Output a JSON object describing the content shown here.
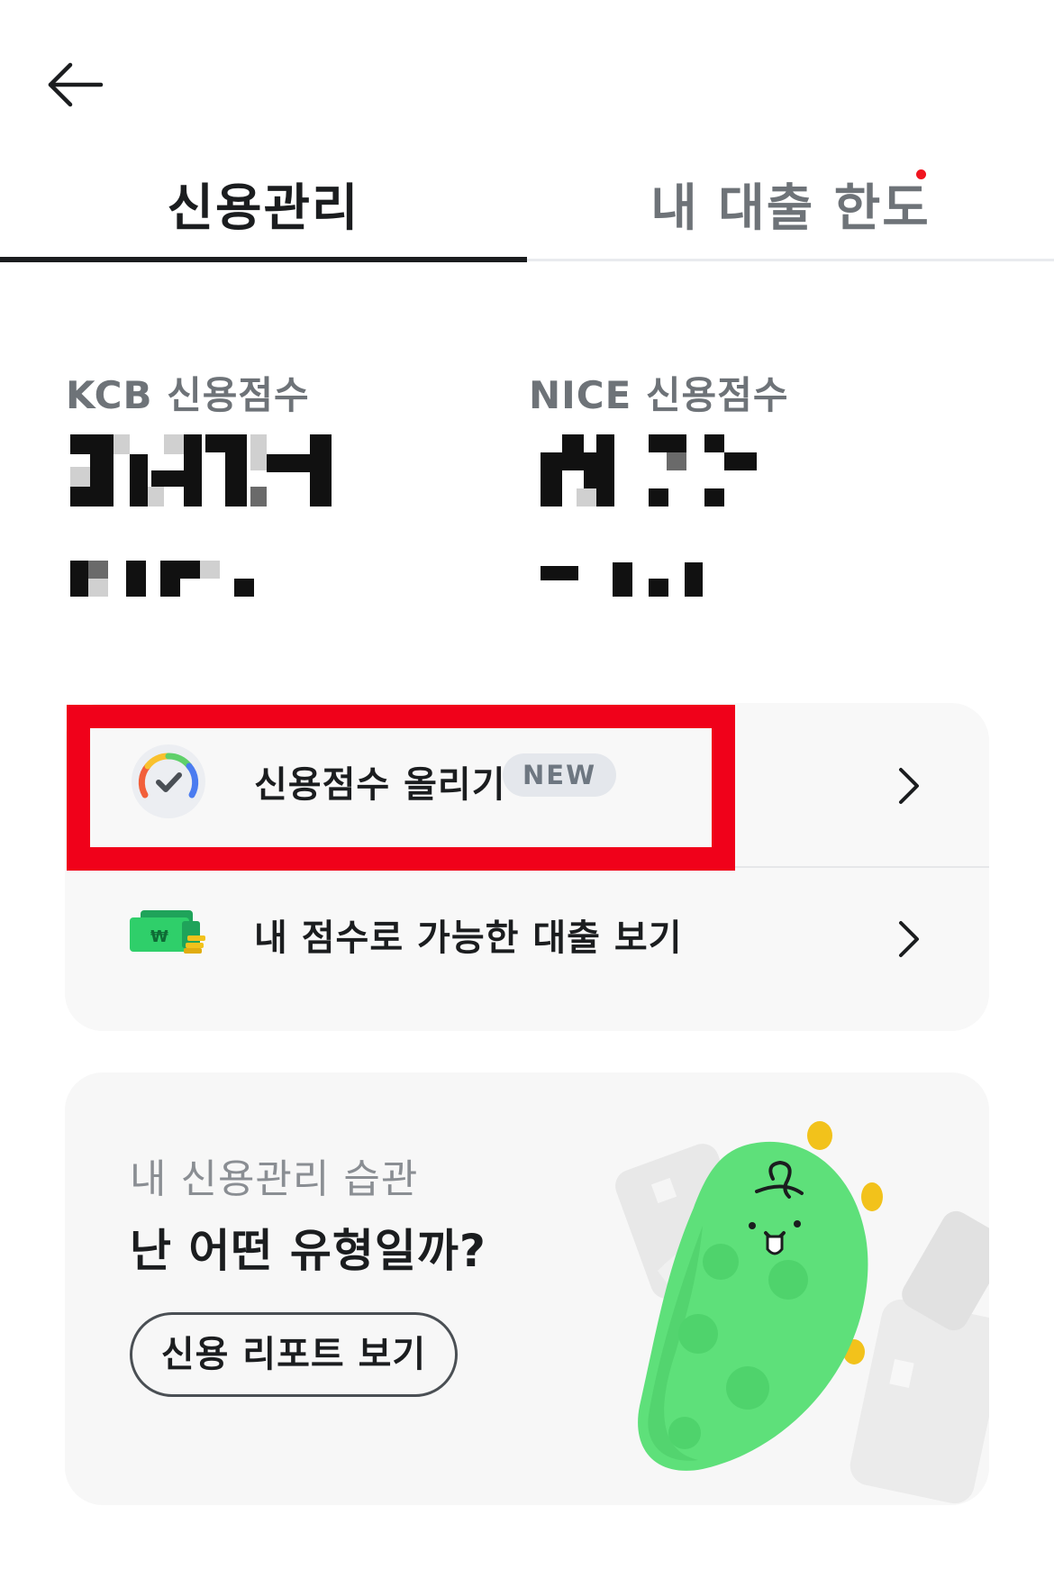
{
  "header": {
    "back_icon": "arrow-left-icon"
  },
  "tabs": [
    {
      "label": "신용관리",
      "active": true
    },
    {
      "label": "내 대출 한도",
      "active": false,
      "has_notification_dot": true
    }
  ],
  "scores": {
    "kcb": {
      "label": "KCB 신용점수",
      "value_hidden": true
    },
    "nice": {
      "label": "NICE 신용점수",
      "value_hidden": true
    }
  },
  "menu": {
    "items": [
      {
        "label": "신용점수 올리기",
        "badge": "NEW",
        "icon": "credit-gauge-icon"
      },
      {
        "label": "내 점수로 가능한 대출 보기",
        "icon": "money-stack-icon"
      }
    ]
  },
  "report": {
    "subtitle": "내 신용관리 습관",
    "title": "난 어떤 유형일까?",
    "button_label": "신용 리포트 보기"
  },
  "colors": {
    "accent_dot": "#f0151f",
    "highlight": "#f0011a",
    "mascot_green": "#5ee07a",
    "badge_bg": "#e4e7ec"
  }
}
